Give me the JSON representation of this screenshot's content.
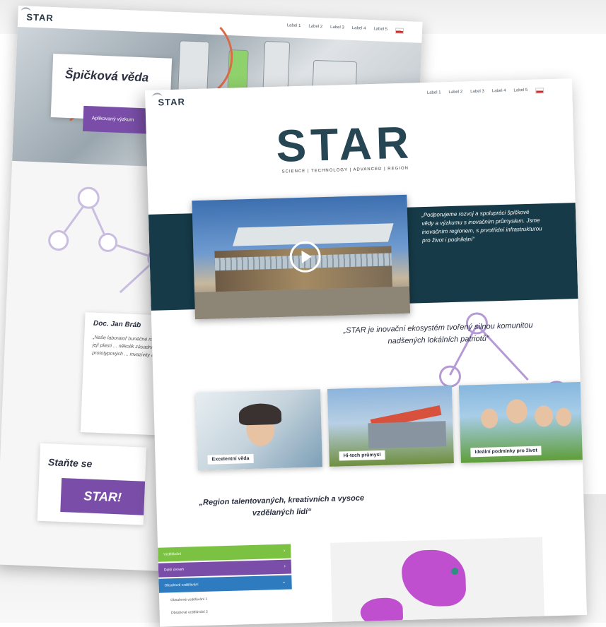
{
  "brand": {
    "logo_small": "STAR",
    "logo_big": "STAR",
    "tagline": "SCIENCE | TECHNOLOGY | ADVANCED | REGION"
  },
  "nav": {
    "links": [
      "Label 1",
      "Label 2",
      "Label 3",
      "Label 4",
      "Label 5"
    ],
    "language": "CZ"
  },
  "back_page": {
    "hero_title": "Špičková věda",
    "hero_button": "Aplikovaný výzkum",
    "quote_author": "Doc. Jan Bráb",
    "quote_text": "„Naše laboratoř buněčné mechaniky ... bunět a její plasti ... několik zásadních ... definovat a ... prototypových ... invazivity a metas...",
    "cta_text": "Staňte se",
    "cta_button": "STAR!"
  },
  "front_page": {
    "band_quote": "„Podporujeme rozvoj a spolupráci špičkové vědy a výzkumu s inovačním průmyslem. Jsme inovačním regionem, s prvotřídní infrastrukturou pro život i podnikání“",
    "main_quote": "„STAR je inovační ekosystém tvořený silnou komunitou nadšených lokálních patriotů“",
    "tiles": [
      "Excelentní věda",
      "Hi-tech průmysl",
      "Ideální podmínky pro život"
    ],
    "bottom_quote": "„Region talentovaných, kreativních a vysoce vzdělaných lidí“",
    "menu": [
      "Vzdělávání",
      "Další úroveň",
      "Obsahové vzdělávání"
    ],
    "sub_menu": [
      "Obsahové vzdělávání 1",
      "Obsahové vzdělávání 2"
    ]
  },
  "colors": {
    "teal": "#163a48",
    "purple": "#7a4ea8",
    "green": "#7cc242",
    "blue": "#2f7bbf",
    "map": "#c04fcf"
  }
}
